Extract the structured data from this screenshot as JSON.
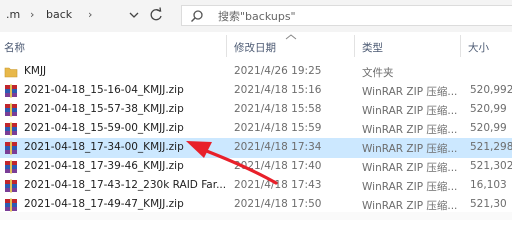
{
  "toolbar": {
    "path_prefix": ".m",
    "path_separator": "›",
    "path_current": "back",
    "search_placeholder": "搜索\"backups\""
  },
  "columns": {
    "name": "名称",
    "modified": "修改日期",
    "type": "类型",
    "size": "大小"
  },
  "files": [
    {
      "name": "KMJJ",
      "modified": "2021/4/26 19:25",
      "type": "文件夹",
      "size": "",
      "icon": "folder-icon"
    },
    {
      "name": "2021-04-18_15-16-04_KMJJ.zip",
      "modified": "2021/4/18 15:16",
      "type": "WinRAR ZIP 压缩...",
      "size": "520,992",
      "icon": "winrar-zip-icon"
    },
    {
      "name": "2021-04-18_15-57-38_KMJJ.zip",
      "modified": "2021/4/18 15:58",
      "type": "WinRAR ZIP 压缩...",
      "size": "520,99",
      "icon": "winrar-zip-icon"
    },
    {
      "name": "2021-04-18_15-59-00_KMJJ.zip",
      "modified": "2021/4/18 15:59",
      "type": "WinRAR ZIP 压缩...",
      "size": "520,99",
      "icon": "winrar-zip-icon"
    },
    {
      "name": "2021-04-18_17-34-00_KMJJ.zip",
      "modified": "2021/4/18 17:34",
      "type": "WinRAR ZIP 压缩...",
      "size": "521,298",
      "icon": "winrar-zip-icon",
      "selected": true
    },
    {
      "name": "2021-04-18_17-39-46_KMJJ.zip",
      "modified": "2021/4/18 17:40",
      "type": "WinRAR ZIP 压缩...",
      "size": "521,302",
      "icon": "winrar-zip-icon"
    },
    {
      "name": "2021-04-18_17-43-12_230k RAID Far...",
      "modified": "2021/4/18 17:43",
      "type": "WinRAR ZIP 压缩...",
      "size": "16,103",
      "icon": "winrar-zip-icon"
    },
    {
      "name": "2021-04-18_17-49-47_KMJJ.zip",
      "modified": "2021/4/18 17:50",
      "type": "WinRAR ZIP 压缩...",
      "size": "521,30",
      "icon": "winrar-zip-icon"
    }
  ],
  "colors": {
    "selected_row": "#cce8ff",
    "annotation_arrow": "#e8202a",
    "folder": "#e8b84a",
    "winrar_red": "#c0262d",
    "winrar_blue": "#2c5bb3",
    "winrar_purple": "#7a3e97"
  }
}
